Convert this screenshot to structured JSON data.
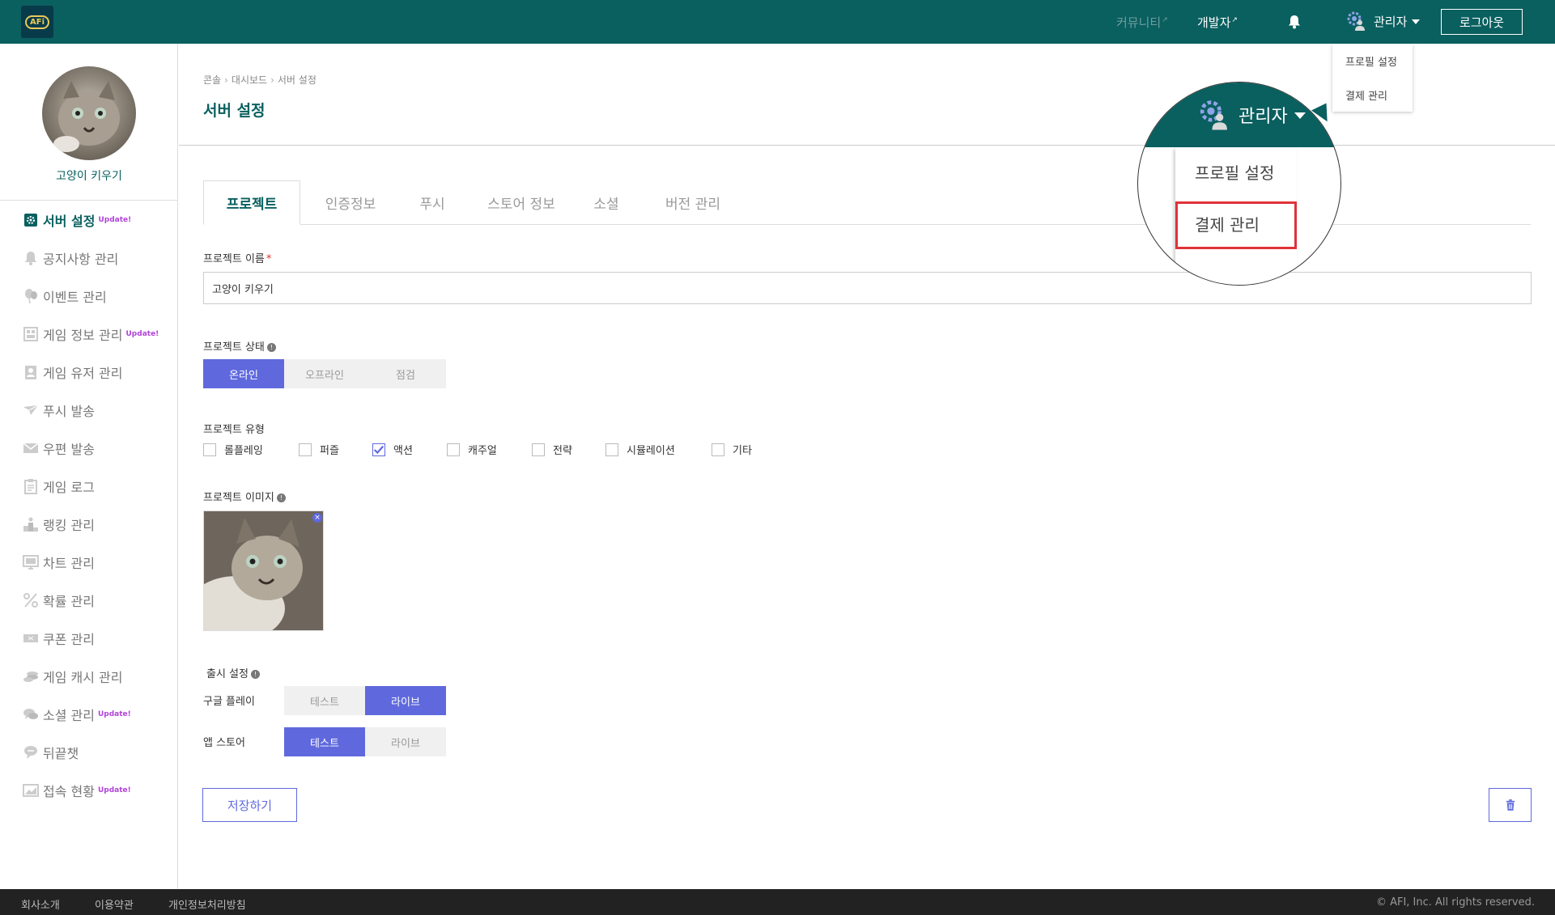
{
  "header": {
    "logo_text": "AFi",
    "community": "커뮤니티",
    "developer": "개발자",
    "admin": "관리자",
    "logout": "로그아웃"
  },
  "admin_menu": [
    "프로필 설정",
    "결제 관리"
  ],
  "sidebar": {
    "profile_name": "고양이 키우기",
    "badge": "Update!",
    "items": [
      {
        "label": "서버 설정",
        "icon": "gear-square-icon",
        "badge": true,
        "active": true
      },
      {
        "label": "공지사항 관리",
        "icon": "bell-icon",
        "badge": false
      },
      {
        "label": "이벤트 관리",
        "icon": "balloon-icon",
        "badge": false
      },
      {
        "label": "게임 정보 관리",
        "icon": "game-info-icon",
        "badge": true
      },
      {
        "label": "게임 유저 관리",
        "icon": "user-card-icon",
        "badge": false
      },
      {
        "label": "푸시 발송",
        "icon": "paper-plane-icon",
        "badge": false
      },
      {
        "label": "우편 발송",
        "icon": "envelope-icon",
        "badge": false
      },
      {
        "label": "게임 로그",
        "icon": "clipboard-icon",
        "badge": false
      },
      {
        "label": "랭킹 관리",
        "icon": "podium-icon",
        "badge": false
      },
      {
        "label": "차트 관리",
        "icon": "monitor-icon",
        "badge": false
      },
      {
        "label": "확률 관리",
        "icon": "percent-icon",
        "badge": false
      },
      {
        "label": "쿠폰 관리",
        "icon": "coupon-icon",
        "badge": false
      },
      {
        "label": "게임 캐시 관리",
        "icon": "coins-icon",
        "badge": false
      },
      {
        "label": "소셜 관리",
        "icon": "chat-bubbles-icon",
        "badge": true
      },
      {
        "label": "뒤끝챗",
        "icon": "chat-icon",
        "badge": false
      },
      {
        "label": "접속 현황",
        "icon": "image-chart-icon",
        "badge": true
      }
    ]
  },
  "breadcrumb": [
    "콘솔",
    "대시보드",
    "서버 설정"
  ],
  "page_title": "서버 설정",
  "tabs": [
    "프로젝트",
    "인증정보",
    "푸시",
    "스토어 정보",
    "소셜",
    "버전 관리"
  ],
  "form": {
    "name_label": "프로젝트 이름",
    "name_required": "*",
    "name_value": "고양이 키우기",
    "status_label": "프로젝트 상태",
    "status_options": [
      "온라인",
      "오프라인",
      "점검"
    ],
    "status_selected": "온라인",
    "type_label": "프로젝트 유형",
    "type_options": [
      {
        "label": "롤플레잉",
        "checked": false
      },
      {
        "label": "퍼즐",
        "checked": false
      },
      {
        "label": "액션",
        "checked": true
      },
      {
        "label": "캐주얼",
        "checked": false
      },
      {
        "label": "전략",
        "checked": false
      },
      {
        "label": "시뮬레이션",
        "checked": false
      },
      {
        "label": "기타",
        "checked": false
      }
    ],
    "image_label": "프로젝트 이미지",
    "release_label": "출시 설정",
    "google_label": "구글 플레이",
    "appstore_label": "앱 스토어",
    "release_options": [
      "테스트",
      "라이브"
    ],
    "google_selected": "라이브",
    "appstore_selected": "테스트",
    "save": "저장하기"
  },
  "footer": {
    "links": [
      "회사소개",
      "이용약관",
      "개인정보처리방침"
    ],
    "copyright": "© AFI, Inc. All rights reserved."
  },
  "colors": {
    "header": "#0a5f5f",
    "accent": "#5f69dd",
    "badge": "#b044d9",
    "highlight": "#e0323a"
  }
}
